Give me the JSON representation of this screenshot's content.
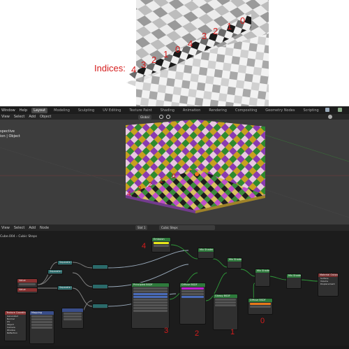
{
  "top_render": {
    "indices_label": "Indices:",
    "front_indices": [
      "4",
      "3",
      "2",
      "1",
      "0"
    ],
    "side_indices": [
      "4",
      "3",
      "2",
      "1",
      "0"
    ]
  },
  "topbar": {
    "menus": [
      "Window",
      "Help"
    ],
    "workspaces": [
      "Layout",
      "Modeling",
      "Sculpting",
      "UV Editing",
      "Texture Paint",
      "Shading",
      "Animation",
      "Rendering",
      "Compositing",
      "Geometry Nodes",
      "Scripting"
    ],
    "active_workspace": "Layout"
  },
  "viewport": {
    "menus": [
      "View",
      "Select",
      "Add",
      "Object"
    ],
    "orientation": "Global",
    "info_line1": "spective",
    "info_line2": "ion | Object",
    "indices": [
      "4",
      "3",
      "2",
      "1",
      "0"
    ]
  },
  "node_editor": {
    "menus": [
      "View",
      "Select",
      "Add",
      "Node"
    ],
    "slot": "Slot 1",
    "material": "Cubic Steps",
    "breadcrumb_object": "Cube.004",
    "breadcrumb_material": "Cubic Steps",
    "node_labels": {
      "principled": "Principled BSDF",
      "emission": "Emission",
      "mix1": "Mix Shader",
      "mix2": "Mix Shader",
      "mix3": "Mix Shader",
      "mix4": "Mix Shader",
      "output": "Material Output",
      "glossy": "Glossy BSDF",
      "diffuse": "Diffuse BSDF",
      "texcoord": "Texture Coordinate",
      "mapping": "Mapping",
      "value": "Value",
      "separate": "Separate XYZ"
    },
    "index_labels": {
      "n4": "4",
      "n3": "3",
      "n2": "2",
      "n1": "1",
      "n0": "0"
    }
  },
  "colors": {
    "accent_red": "#d51c1c",
    "emission_color": "#e8e81a",
    "orange_swatch": "#e87a1a",
    "purple_swatch": "#c020d0",
    "blue_field": "#4a6bb8"
  }
}
